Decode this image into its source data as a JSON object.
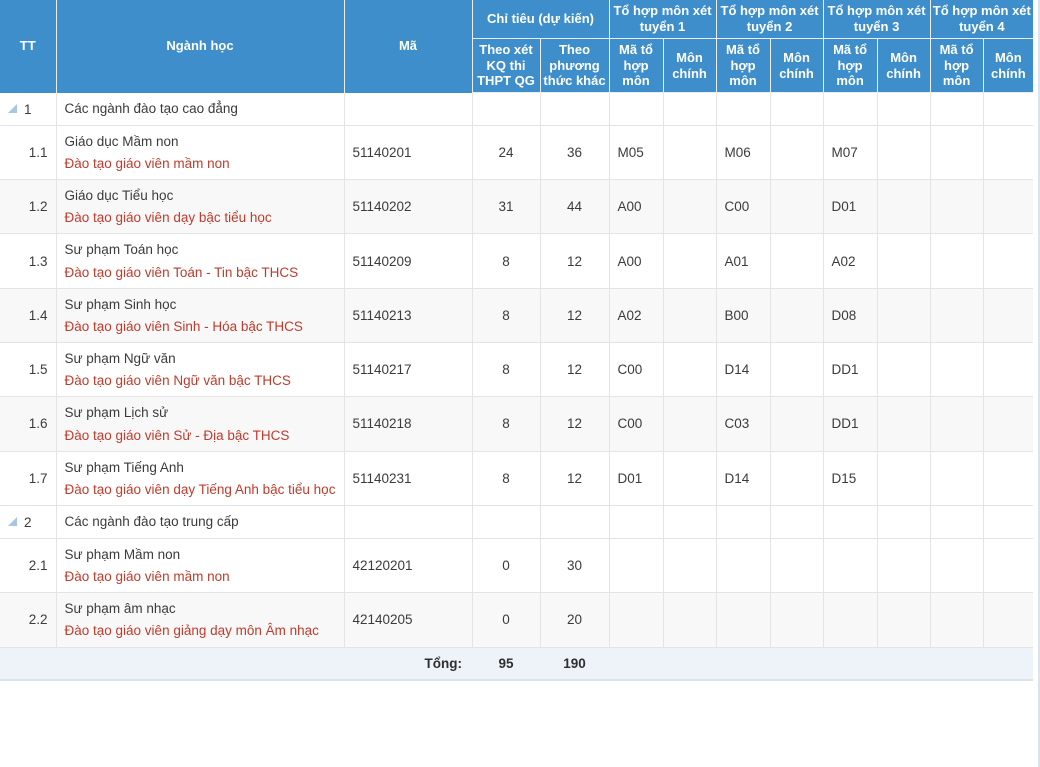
{
  "table": {
    "headers": {
      "tt": "TT",
      "nganh_hoc": "Ngành học",
      "ma": "Mã",
      "chi_tieu": "Chỉ tiêu (dự kiến)",
      "theo_xet_kq": "Theo xét KQ thi THPT QG",
      "theo_pt_khac": "Theo phương thức khác",
      "to_hop_1": "Tổ hợp môn xét tuyển 1",
      "to_hop_2": "Tổ hợp môn xét tuyển 2",
      "to_hop_3": "Tổ hợp môn xét tuyển 3",
      "to_hop_4": "Tổ hợp môn xét tuyển 4",
      "ma_to_hop_mon": "Mã tổ hợp môn",
      "mon_chinh": "Môn chính"
    },
    "rows": [
      {
        "type": "group",
        "tt": "1",
        "name": "Các ngành đào tạo cao đẳng",
        "ma": "",
        "kq_thi": "",
        "pt_khac": "",
        "th1_ma": "",
        "th1_mon": "",
        "th2_ma": "",
        "th2_mon": "",
        "th3_ma": "",
        "th3_mon": "",
        "th4_ma": "",
        "th4_mon": ""
      },
      {
        "type": "item",
        "tt": "1.1",
        "name": "Giáo dục Mầm non",
        "sub": "Đào tạo giáo viên mầm non",
        "ma": "51140201",
        "kq_thi": "24",
        "pt_khac": "36",
        "th1_ma": "M05",
        "th1_mon": "",
        "th2_ma": "M06",
        "th2_mon": "",
        "th3_ma": "M07",
        "th3_mon": "",
        "th4_ma": "",
        "th4_mon": ""
      },
      {
        "type": "item",
        "tt": "1.2",
        "name": "Giáo dục Tiểu học",
        "sub": "Đào tạo giáo viên dạy bậc tiểu học",
        "ma": "51140202",
        "kq_thi": "31",
        "pt_khac": "44",
        "th1_ma": "A00",
        "th1_mon": "",
        "th2_ma": "C00",
        "th2_mon": "",
        "th3_ma": "D01",
        "th3_mon": "",
        "th4_ma": "",
        "th4_mon": ""
      },
      {
        "type": "item",
        "tt": "1.3",
        "name": "Sư phạm Toán học",
        "sub": "Đào tạo giáo viên Toán - Tin bậc THCS",
        "ma": "51140209",
        "kq_thi": "8",
        "pt_khac": "12",
        "th1_ma": "A00",
        "th1_mon": "",
        "th2_ma": "A01",
        "th2_mon": "",
        "th3_ma": "A02",
        "th3_mon": "",
        "th4_ma": "",
        "th4_mon": ""
      },
      {
        "type": "item",
        "tt": "1.4",
        "name": "Sư phạm Sinh học",
        "sub": "Đào tạo giáo viên Sinh - Hóa bậc THCS",
        "ma": "51140213",
        "kq_thi": "8",
        "pt_khac": "12",
        "th1_ma": "A02",
        "th1_mon": "",
        "th2_ma": "B00",
        "th2_mon": "",
        "th3_ma": "D08",
        "th3_mon": "",
        "th4_ma": "",
        "th4_mon": ""
      },
      {
        "type": "item",
        "tt": "1.5",
        "name": "Sư phạm Ngữ văn",
        "sub": "Đào tạo giáo viên Ngữ văn bậc THCS",
        "ma": "51140217",
        "kq_thi": "8",
        "pt_khac": "12",
        "th1_ma": "C00",
        "th1_mon": "",
        "th2_ma": "D14",
        "th2_mon": "",
        "th3_ma": "DD1",
        "th3_mon": "",
        "th4_ma": "",
        "th4_mon": ""
      },
      {
        "type": "item",
        "tt": "1.6",
        "name": "Sư phạm Lịch sử",
        "sub": "Đào tạo giáo viên Sử - Địa bậc THCS",
        "ma": "51140218",
        "kq_thi": "8",
        "pt_khac": "12",
        "th1_ma": "C00",
        "th1_mon": "",
        "th2_ma": "C03",
        "th2_mon": "",
        "th3_ma": "DD1",
        "th3_mon": "",
        "th4_ma": "",
        "th4_mon": ""
      },
      {
        "type": "item",
        "tt": "1.7",
        "name": "Sư phạm Tiếng Anh",
        "sub": "Đào tạo giáo viên dạy Tiếng Anh bậc tiểu học",
        "ma": "51140231",
        "kq_thi": "8",
        "pt_khac": "12",
        "th1_ma": "D01",
        "th1_mon": "",
        "th2_ma": "D14",
        "th2_mon": "",
        "th3_ma": "D15",
        "th3_mon": "",
        "th4_ma": "",
        "th4_mon": ""
      },
      {
        "type": "group",
        "tt": "2",
        "name": "Các ngành đào tạo trung cấp",
        "ma": "",
        "kq_thi": "",
        "pt_khac": "",
        "th1_ma": "",
        "th1_mon": "",
        "th2_ma": "",
        "th2_mon": "",
        "th3_ma": "",
        "th3_mon": "",
        "th4_ma": "",
        "th4_mon": ""
      },
      {
        "type": "item",
        "tt": "2.1",
        "name": "Sư phạm Mầm non",
        "sub": "Đào tạo giáo viên mầm non",
        "ma": "42120201",
        "kq_thi": "0",
        "pt_khac": "30",
        "th1_ma": "",
        "th1_mon": "",
        "th2_ma": "",
        "th2_mon": "",
        "th3_ma": "",
        "th3_mon": "",
        "th4_ma": "",
        "th4_mon": ""
      },
      {
        "type": "item",
        "tt": "2.2",
        "name": "Sư phạm âm nhạc",
        "sub": "Đào tạo giáo viên giảng dạy môn Âm nhạc",
        "ma": "42140205",
        "kq_thi": "0",
        "pt_khac": "20",
        "th1_ma": "",
        "th1_mon": "",
        "th2_ma": "",
        "th2_mon": "",
        "th3_ma": "",
        "th3_mon": "",
        "th4_ma": "",
        "th4_mon": ""
      }
    ],
    "footer": {
      "label": "Tổng:",
      "kq_thi_total": "95",
      "pt_khac_total": "190"
    }
  },
  "icons": {
    "collapse": "collapse-triangle-icon"
  },
  "colors": {
    "header_blue": "#3d8ecb",
    "sub_text_red": "#bf3b2c",
    "alt_row": "#f8f8f8",
    "footer_bg": "#eef2f9",
    "border": "#e4e4e4"
  }
}
